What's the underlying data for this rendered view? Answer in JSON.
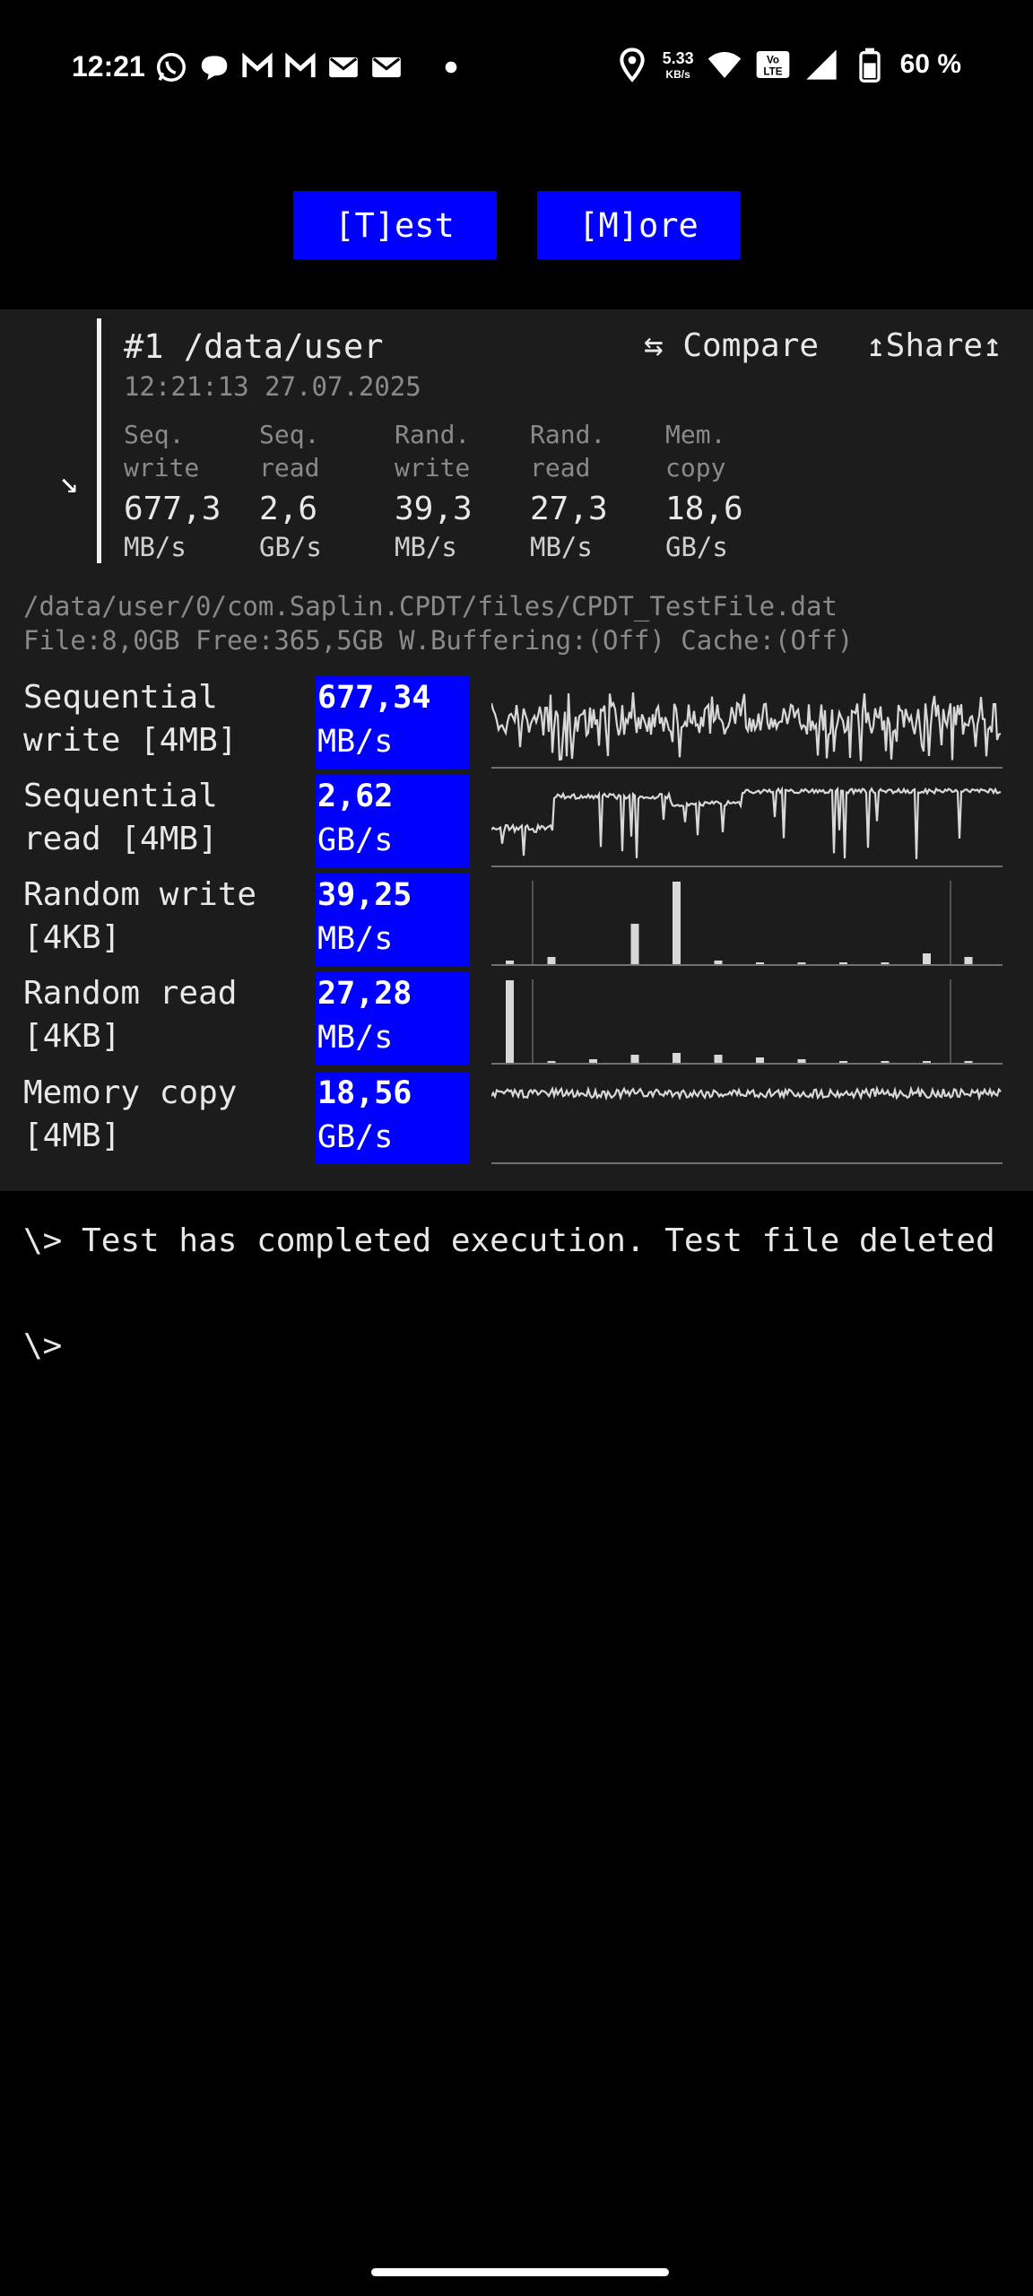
{
  "status_bar": {
    "time": "12:21",
    "net_speed_value": "5.33",
    "net_speed_unit": "KB/s",
    "volte": "Vo\nLTE",
    "battery_text": "60 %",
    "notification_icons": [
      "whatsapp-icon",
      "chat-bubble-icon",
      "gmail-icon",
      "gmail-icon",
      "mail-icon",
      "mail-icon",
      "dot-icon"
    ],
    "right_icons": [
      "location-icon",
      "wifi-icon",
      "volte-icon",
      "signal-icon",
      "battery-icon"
    ]
  },
  "buttons": {
    "test": "[T]est",
    "more": "[M]ore"
  },
  "result": {
    "title": "#1 /data/user",
    "compare": "⇆ Compare",
    "share": "↥Share↥",
    "datetime": "12:21:13 27.07.2025",
    "arrow": "↘",
    "summary": [
      {
        "label1": "Seq.",
        "label2": "write",
        "value": "677,3",
        "unit": "MB/s"
      },
      {
        "label1": "Seq.",
        "label2": "read",
        "value": "2,6",
        "unit": "GB/s"
      },
      {
        "label1": "Rand.",
        "label2": "write",
        "value": "39,3",
        "unit": "MB/s"
      },
      {
        "label1": "Rand.",
        "label2": "read",
        "value": "27,3",
        "unit": "MB/s"
      },
      {
        "label1": "Mem.",
        "label2": "copy",
        "value": "18,6",
        "unit": "GB/s"
      }
    ],
    "file_path": "/data/user/0/com.Saplin.CPDT/files/CPDT_TestFile.dat",
    "file_info": "File:8,0GB Free:365,5GB W.Buffering:(Off) Cache:(Off)",
    "tests": [
      {
        "name1": "Sequential",
        "name2": "write [4MB]",
        "value": "677,34",
        "unit": "MB/s"
      },
      {
        "name1": "Sequential",
        "name2": "read [4MB]",
        "value": "2,62",
        "unit": "GB/s"
      },
      {
        "name1": "Random write",
        "name2": "[4KB]",
        "value": "39,25",
        "unit": "MB/s"
      },
      {
        "name1": "Random read",
        "name2": "[4KB]",
        "value": "27,28",
        "unit": "MB/s"
      },
      {
        "name1": "Memory copy",
        "name2": "[4MB]",
        "value": "18,56",
        "unit": "GB/s"
      }
    ]
  },
  "console": {
    "message": "\\> Test has completed execution. Test file deleted",
    "prompt": "\\>"
  }
}
